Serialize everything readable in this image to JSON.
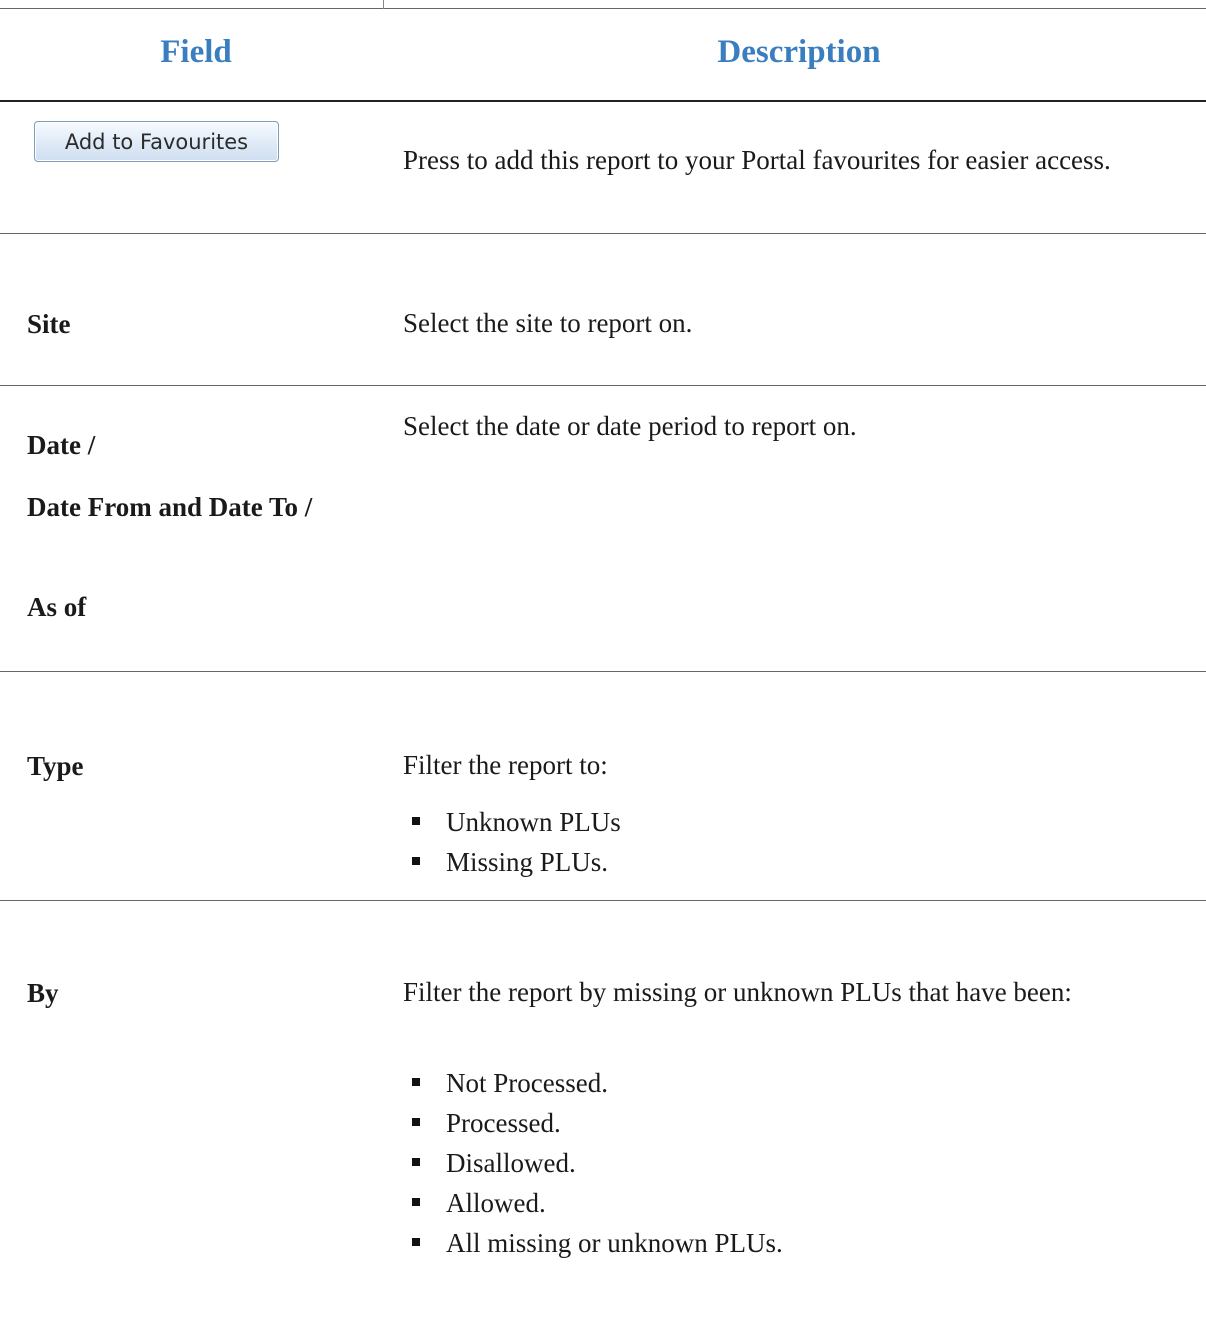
{
  "table": {
    "headers": {
      "field": "Field",
      "description": "Description"
    },
    "rows": [
      {
        "field_button": "Add to Favourites",
        "description": "Press to add this report to your Portal favourites for easier access."
      },
      {
        "field": "Site",
        "description": "Select the site to report on."
      },
      {
        "field_lines": [
          "Date /",
          "Date From and Date To /",
          "As of"
        ],
        "description": "Select the date or date period to report on."
      },
      {
        "field": "Type",
        "description": "Filter the report to:",
        "bullets": [
          "Unknown PLUs",
          "Missing PLUs."
        ]
      },
      {
        "field": "By",
        "description": "Filter the report by missing or unknown PLUs that have been:",
        "bullets": [
          "Not Processed.",
          "Processed.",
          "Disallowed.",
          "Allowed.",
          "All missing or unknown PLUs."
        ]
      }
    ]
  },
  "colors": {
    "header_text": "#3a7ec0",
    "body_text": "#1a1a1a",
    "rule": "#555555"
  }
}
